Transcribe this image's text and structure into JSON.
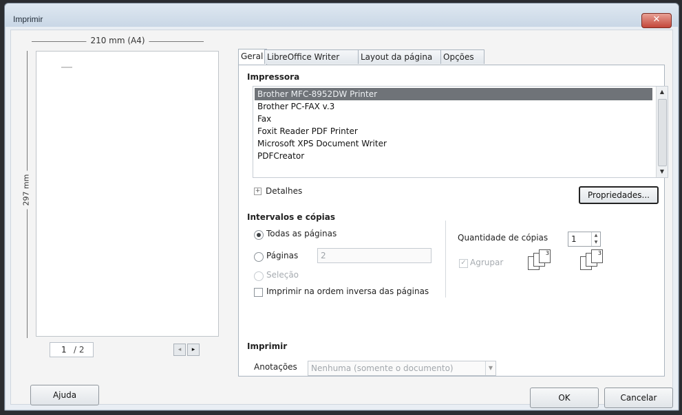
{
  "window": {
    "title": "Imprimir",
    "close_label": "✕"
  },
  "preview": {
    "width_label": "210 mm (A4)",
    "height_label": "297 mm",
    "page_current": "1",
    "page_total": "/ 2",
    "prev_icon": "◂",
    "next_icon": "▸"
  },
  "tabs": [
    {
      "label": "Geral"
    },
    {
      "label": "LibreOffice Writer"
    },
    {
      "label": "Layout da página"
    },
    {
      "label": "Opções"
    }
  ],
  "printer": {
    "section_title": "Impressora",
    "items": [
      "Brother MFC-8952DW Printer",
      "Brother PC-FAX v.3",
      "Fax",
      "Foxit Reader PDF Printer",
      "Microsoft XPS Document Writer",
      "PDFCreator"
    ],
    "selected_index": 0,
    "details_label": "Detalhes",
    "properties_label": "Propriedades..."
  },
  "ranges": {
    "section_title": "Intervalos e cópias",
    "all_pages_label": "Todas as páginas",
    "pages_label": "Páginas",
    "pages_value": "2",
    "selection_label": "Seleção",
    "reverse_label": "Imprimir na ordem inversa das páginas",
    "copies_label": "Quantidade de cópias",
    "copies_value": "1",
    "collate_label": "Agrupar",
    "collate_check": "✓"
  },
  "print": {
    "section_title": "Imprimir",
    "annotations_label": "Anotações",
    "annotations_value": "Nenhuma (somente o documento)"
  },
  "buttons": {
    "help": "Ajuda",
    "ok": "OK",
    "cancel": "Cancelar"
  },
  "colors": {
    "selection": "#6f7378",
    "title_gradient_top": "#dfe8f1"
  }
}
